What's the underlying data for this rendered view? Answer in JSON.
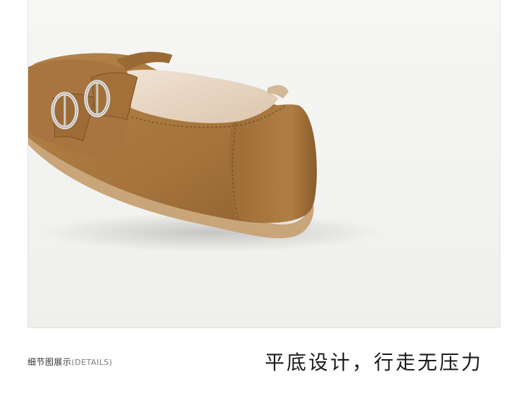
{
  "caption": {
    "label": "细节图展示",
    "tag": "(DETAILS)"
  },
  "headline": "平底设计，行走无压力",
  "colors": {
    "suede": "#a8783f",
    "suede_dark": "#7a5224",
    "sole": "#c9a57a",
    "lining": "#e9d9c8",
    "buckle": "#d9d9d9",
    "backdrop": "#f4f4f2"
  },
  "image": {
    "subject": "suede-flat-shoe-with-double-buckle-straps"
  }
}
